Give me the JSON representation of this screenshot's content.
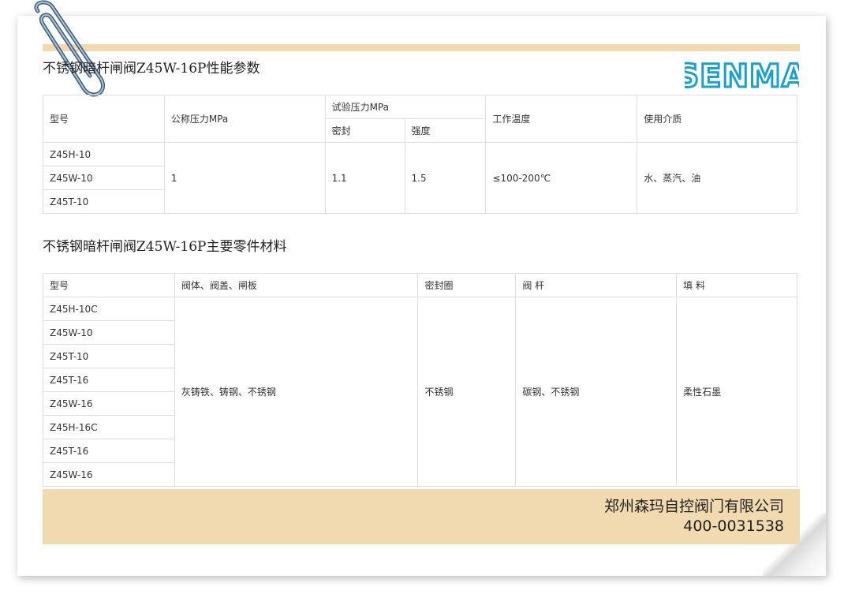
{
  "colors": {
    "band": "#f2dab0",
    "logo_blue": "#1aa0d0",
    "border": "#dedede"
  },
  "title1": "不锈钢暗杆闸阀Z45W-16P性能参数",
  "title2": "不锈钢暗杆闸阀Z45W-16P主要零件材料",
  "logo_text": "SENMA",
  "params": {
    "headers": {
      "model": "型号",
      "nominal_pressure": "公称压力MPa",
      "test_pressure": "试验压力MPa",
      "seal": "密封",
      "strength": "强度",
      "work_temp": "工作温度",
      "medium": "使用介质"
    },
    "models": [
      "Z45H-10",
      "Z45W-10",
      "Z45T-10"
    ],
    "nominal_pressure": "1",
    "seal": "1.1",
    "strength": "1.5",
    "work_temp": "≤100-200℃",
    "medium": "水、蒸汽、油"
  },
  "materials": {
    "headers": {
      "model": "型号",
      "body": "阀体、阀盖、闸板",
      "seal_ring": "密封圈",
      "stem": "阀 杆",
      "packing": "填 料"
    },
    "models": [
      "Z45H-10C",
      "Z45W-10",
      "Z45T-10",
      "Z45T-16",
      "Z45W-16",
      "Z45H-16C",
      "Z45T-16",
      "Z45W-16"
    ],
    "body": "灰铸铁、铸钢、不锈钢",
    "seal_ring": "不锈钢",
    "stem": "碳钢、不锈钢",
    "packing": "柔性石墨"
  },
  "footer": {
    "company": "郑州森玛自控阀门有限公司",
    "phone": "400-0031538"
  }
}
